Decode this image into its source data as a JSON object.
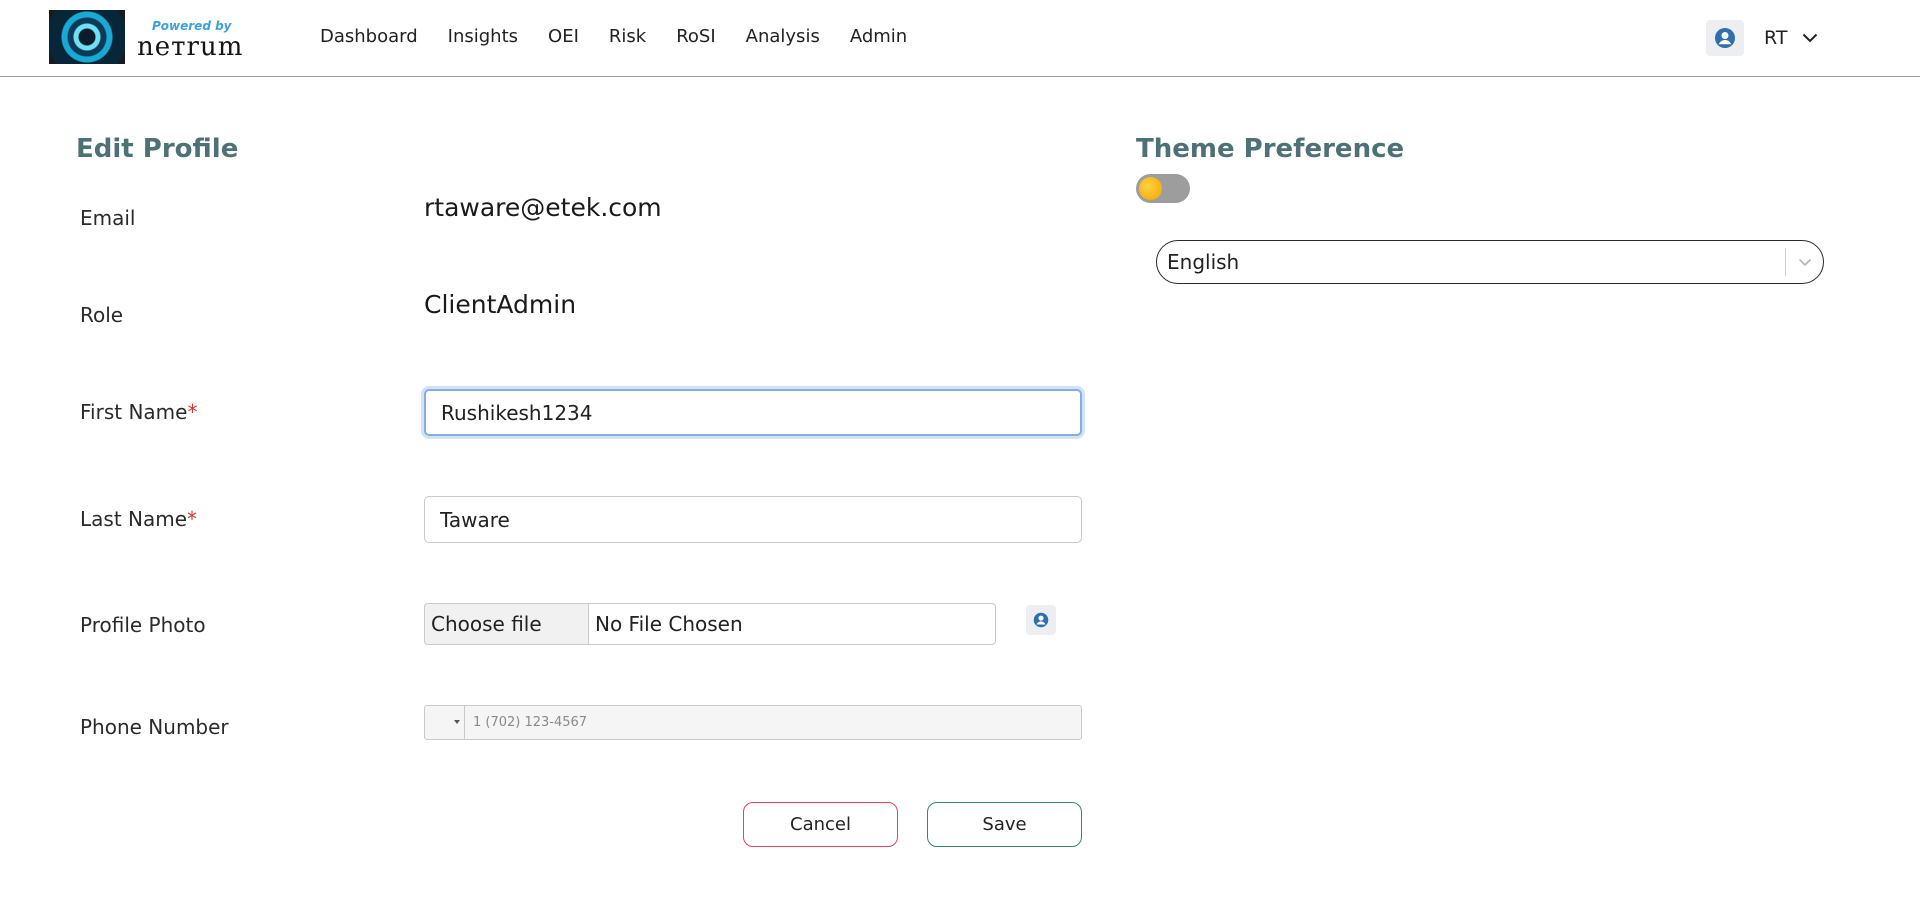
{
  "header": {
    "logo": {
      "powered_by": "Powered by",
      "brand": "nетrum"
    },
    "nav": [
      {
        "label": "Dashboard"
      },
      {
        "label": "Insights"
      },
      {
        "label": "OEI"
      },
      {
        "label": "Risk"
      },
      {
        "label": "RoSI"
      },
      {
        "label": "Analysis"
      },
      {
        "label": "Admin"
      }
    ],
    "user": {
      "initials": "RT",
      "avatar_icon": "user-circle-icon",
      "menu_icon": "chevron-down-icon"
    }
  },
  "profile": {
    "title": "Edit Profile",
    "email": {
      "label": "Email",
      "value": "rtaware@etek.com"
    },
    "role": {
      "label": "Role",
      "value": "ClientAdmin"
    },
    "first_name": {
      "label": "First Name",
      "required_mark": "*",
      "value": "Rushikesh1234"
    },
    "last_name": {
      "label": "Last Name",
      "required_mark": "*",
      "value": "Taware"
    },
    "profile_photo": {
      "label": "Profile Photo",
      "choose_label": "Choose file",
      "file_status": "No File Chosen",
      "preview_icon": "user-circle-icon"
    },
    "phone": {
      "label": "Phone Number",
      "placeholder": "1 (702) 123-4567"
    },
    "cancel_label": "Cancel",
    "save_label": "Save"
  },
  "preferences": {
    "title": "Theme Preference",
    "theme_toggle": {
      "on": false,
      "knob_color": "#f4a300"
    },
    "language": {
      "value": "English"
    }
  },
  "colors": {
    "heading": "#4e7178",
    "cancel_border": "#e0475b",
    "save_border": "#2f8a6a",
    "required": "#dd3333",
    "focus_ring": "#86aee0"
  }
}
